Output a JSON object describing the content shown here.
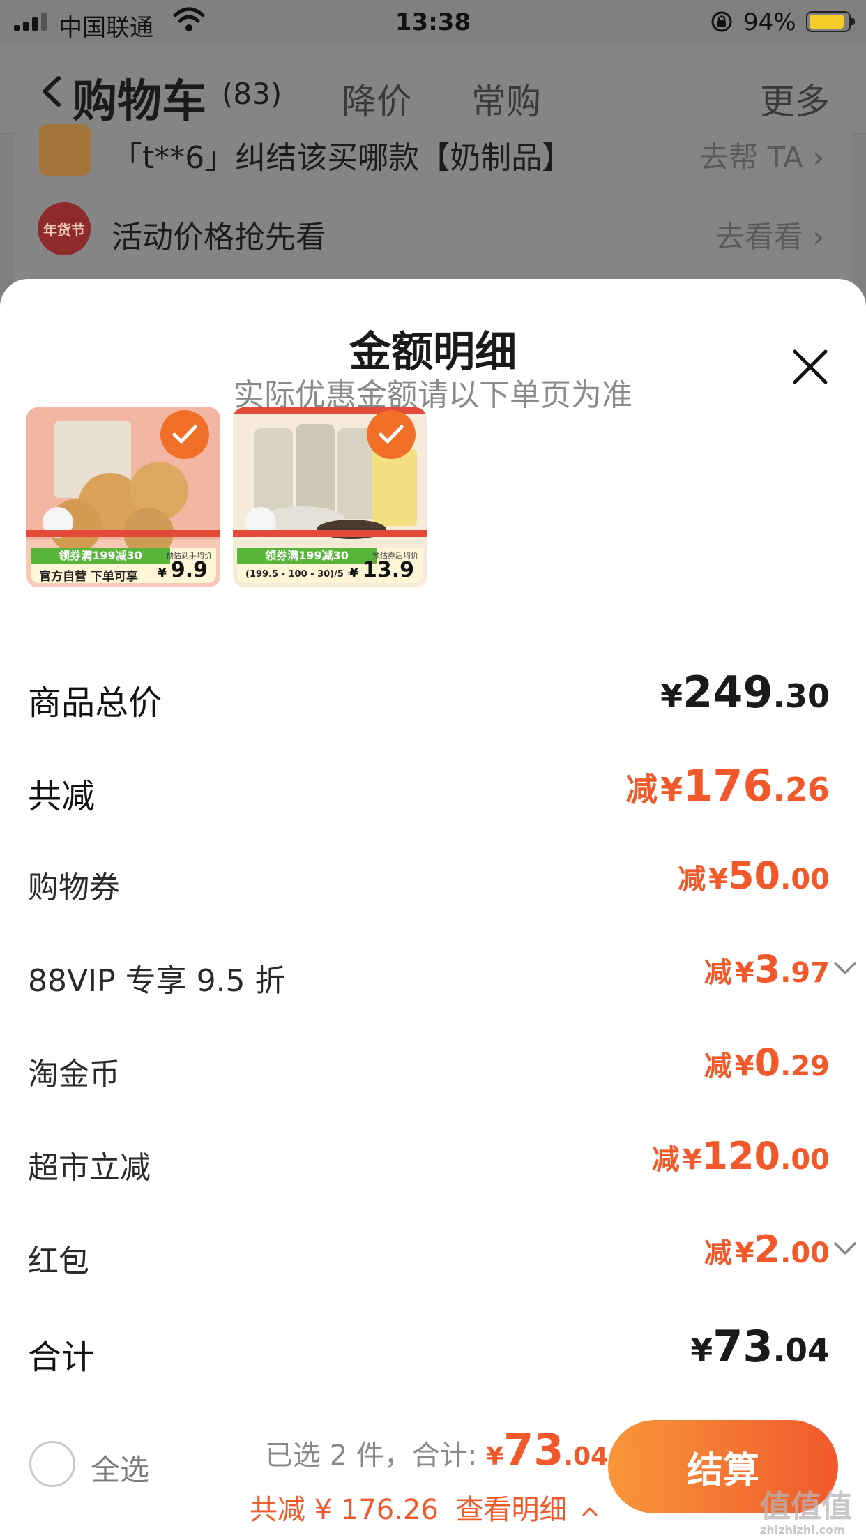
{
  "status_bar": {
    "carrier": "中国联通",
    "time": "13:38",
    "battery": "94%",
    "battery_level": 0.94
  },
  "nav": {
    "back_icon": "chevron-left-icon",
    "title": "购物车",
    "count": "(83)",
    "tabs": [
      "降价",
      "常购",
      "更多"
    ]
  },
  "background_card": {
    "row1_text": "「t**6」纠结该买哪款【奶制品】",
    "row1_link": "去帮 TA",
    "row2_badge": "年货节",
    "row2_text": "活动价格抢先看",
    "row2_link": "去看看"
  },
  "sheet": {
    "title": "金额明细",
    "subtitle": "实际优惠金额请以下单页为准",
    "close_icon": "close-icon",
    "products": [
      {
        "name": "biscuits",
        "promo_band": "领券满199减30",
        "promo_sub": "官方自营 下单可享",
        "price_label": "预估到手均价",
        "price_yen": "¥",
        "price": "9.9",
        "selected": true
      },
      {
        "name": "charcoal-coffee",
        "promo_band": "领券满199减30",
        "promo_sub": "(199.5 - 100 - 30)/5 =",
        "price_label": "预估券后均价",
        "price_yen": "¥",
        "price": "13.9",
        "selected": true
      }
    ],
    "rows": [
      {
        "label": "商品总价",
        "prefix": "",
        "yen": "¥",
        "int": "249",
        "dec": ".30",
        "style": "plain-bold",
        "chevron": false
      },
      {
        "label": "共减",
        "prefix": "减",
        "yen": "¥",
        "int": "176",
        "dec": ".26",
        "style": "red-bold",
        "chevron": false
      },
      {
        "label": "购物券",
        "prefix": "减",
        "yen": "¥",
        "int": "50",
        "dec": ".00",
        "style": "red-small",
        "chevron": false
      },
      {
        "label": "88VIP 专享 9.5 折",
        "prefix": "减",
        "yen": "¥",
        "int": "3",
        "dec": ".97",
        "style": "red-small",
        "chevron": true
      },
      {
        "label": "淘金币",
        "prefix": "减",
        "yen": "¥",
        "int": "0",
        "dec": ".29",
        "style": "red-small",
        "chevron": false
      },
      {
        "label": "超市立减",
        "prefix": "减",
        "yen": "¥",
        "int": "120",
        "dec": ".00",
        "style": "red-small",
        "chevron": false
      },
      {
        "label": "红包",
        "prefix": "减",
        "yen": "¥",
        "int": "2",
        "dec": ".00",
        "style": "red-small",
        "chevron": true
      },
      {
        "label": "合计",
        "prefix": "",
        "yen": "¥",
        "int": "73",
        "dec": ".04",
        "style": "plain-bold",
        "chevron": false
      }
    ]
  },
  "footer": {
    "select_all": "全选",
    "summary_prefix": "已选 2 件，合计:",
    "total_yen": "¥",
    "total_int": "73",
    "total_dec": ".04",
    "saving": "共减 ¥ 176.26",
    "detail": "查看明细",
    "checkout": "结算"
  },
  "watermark": {
    "big": "值值值",
    "small": "zhizhizhi.com"
  },
  "colors": {
    "accent": "#f1592a",
    "checkout_start": "#f9963a",
    "checkout_end": "#f0592c"
  }
}
